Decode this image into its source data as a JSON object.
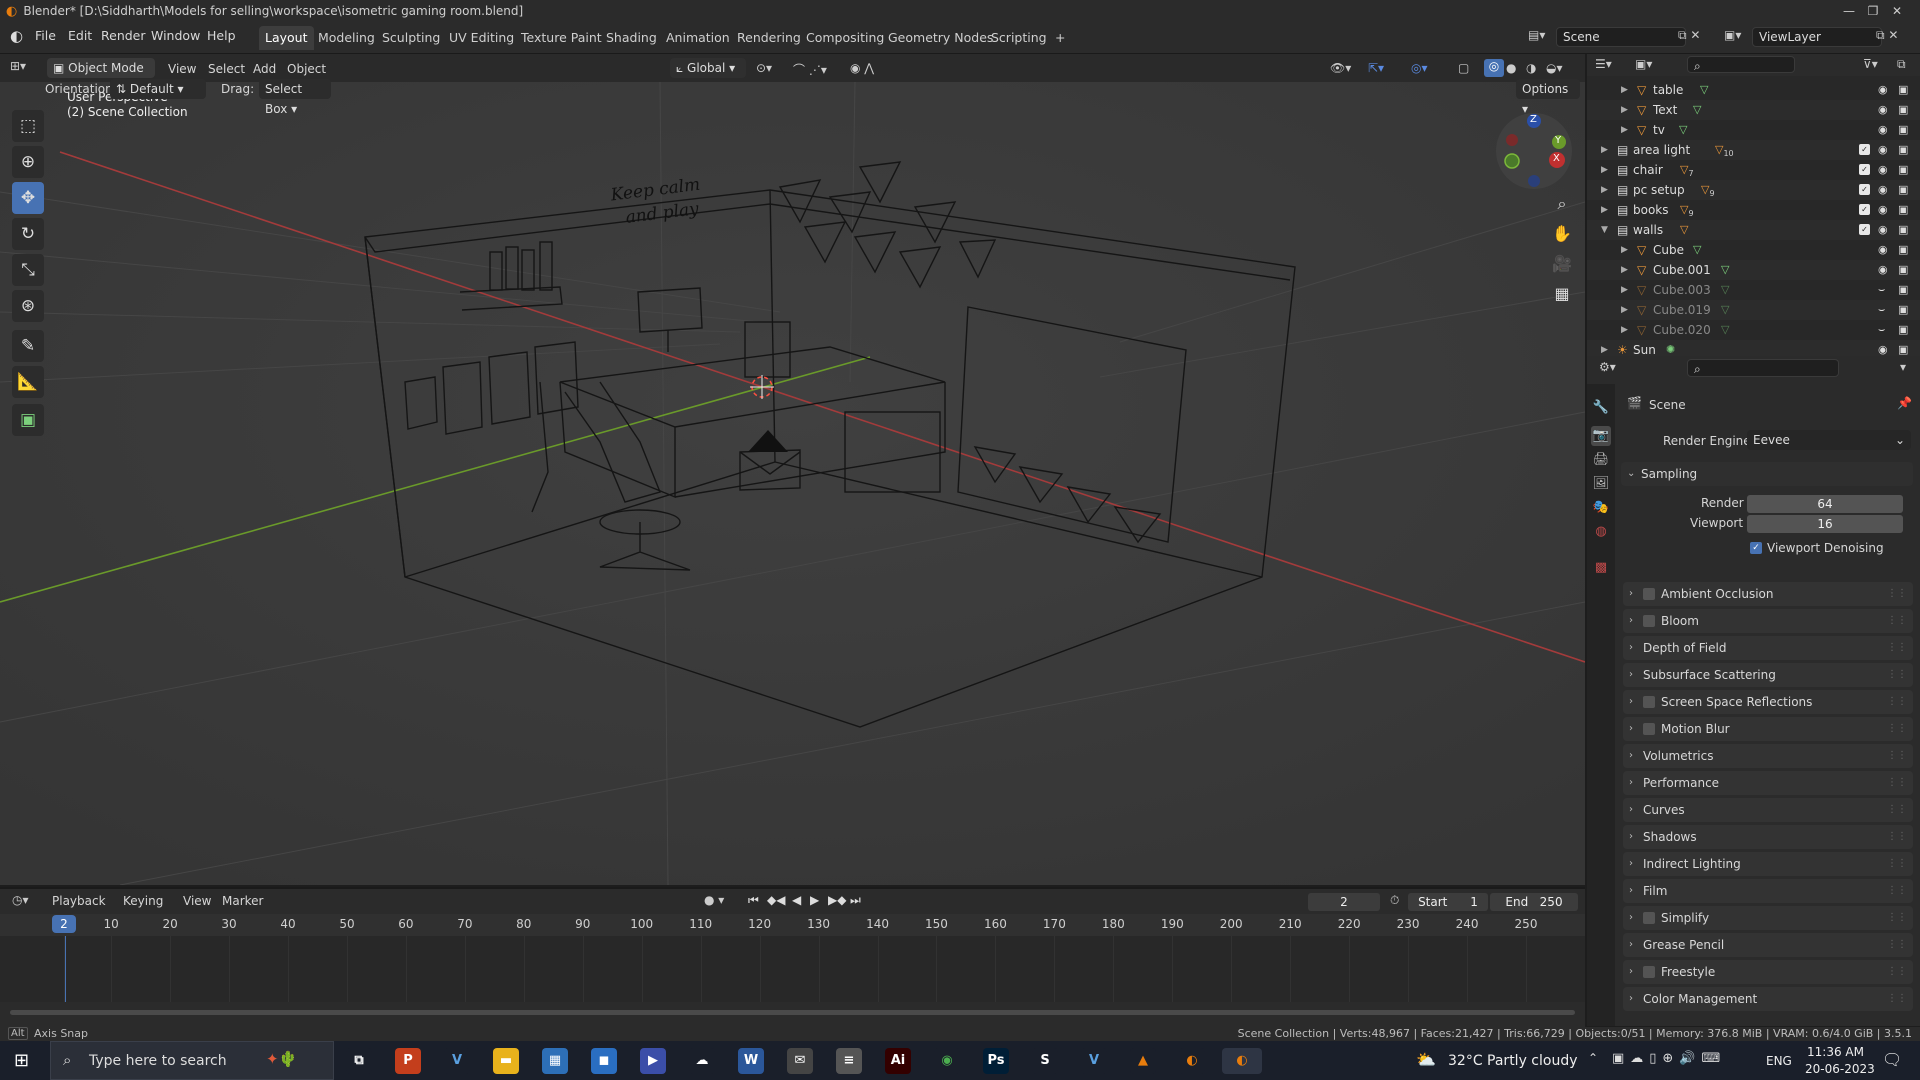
{
  "window": {
    "title": "Blender* [D:\\Siddharth\\Models for selling\\workspace\\isometric gaming room.blend]",
    "controls": [
      "—",
      "❐",
      "✕"
    ]
  },
  "menu": [
    "File",
    "Edit",
    "Render",
    "Window",
    "Help"
  ],
  "workspaces": [
    "Layout",
    "Modeling",
    "Sculpting",
    "UV Editing",
    "Texture Paint",
    "Shading",
    "Animation",
    "Rendering",
    "Compositing",
    "Geometry Nodes",
    "Scripting",
    "+"
  ],
  "scene_name": "Scene",
  "view_layer": "ViewLayer",
  "viewport_header": {
    "mode": "Object Mode",
    "menus": [
      "View",
      "Select",
      "Add",
      "Object"
    ],
    "transform": "Global",
    "orientation_label": "Orientation:",
    "orientation_value": "Default",
    "drag_label": "Drag:",
    "drag_value": "Select Box",
    "options": "Options"
  },
  "viewport": {
    "perspective": "User Perspective",
    "collection": "(2) Scene Collection",
    "gizmo_axes": [
      "Z",
      "Y",
      "X"
    ],
    "wall_text": [
      "Keep calm",
      "and play"
    ]
  },
  "toolbar_icons": [
    "select-box",
    "cursor",
    "move",
    "rotate",
    "scale",
    "transform",
    "annotate",
    "measure",
    "add-cube"
  ],
  "outliner": [
    {
      "name": "table",
      "indent": 2,
      "dim": false
    },
    {
      "name": "Text",
      "indent": 2,
      "dim": false
    },
    {
      "name": "tv",
      "indent": 2,
      "dim": false
    },
    {
      "name": "area light",
      "indent": 1,
      "dim": false,
      "count": "10"
    },
    {
      "name": "chair",
      "indent": 1,
      "dim": false,
      "count": "7"
    },
    {
      "name": "pc setup",
      "indent": 1,
      "dim": false,
      "count": "9"
    },
    {
      "name": "books",
      "indent": 1,
      "dim": false,
      "count": "9"
    },
    {
      "name": "walls",
      "indent": 1,
      "dim": false
    },
    {
      "name": "Cube",
      "indent": 2,
      "dim": false
    },
    {
      "name": "Cube.001",
      "indent": 2,
      "dim": false
    },
    {
      "name": "Cube.003",
      "indent": 2,
      "dim": true
    },
    {
      "name": "Cube.019",
      "indent": 2,
      "dim": true
    },
    {
      "name": "Cube.020",
      "indent": 2,
      "dim": true
    },
    {
      "name": "Sun",
      "indent": 1,
      "dim": false
    }
  ],
  "properties": {
    "context": "Scene",
    "render_engine_label": "Render Engine",
    "render_engine": "Eevee",
    "sampling_title": "Sampling",
    "render_label": "Render",
    "render_value": "64",
    "viewport_label": "Viewport",
    "viewport_value": "16",
    "denoise_label": "Viewport Denoising",
    "panels": [
      {
        "label": "Ambient Occlusion",
        "checkbox": true
      },
      {
        "label": "Bloom",
        "checkbox": true
      },
      {
        "label": "Depth of Field",
        "checkbox": false
      },
      {
        "label": "Subsurface Scattering",
        "checkbox": false
      },
      {
        "label": "Screen Space Reflections",
        "checkbox": true
      },
      {
        "label": "Motion Blur",
        "checkbox": true
      },
      {
        "label": "Volumetrics",
        "checkbox": false
      },
      {
        "label": "Performance",
        "checkbox": false
      },
      {
        "label": "Curves",
        "checkbox": false
      },
      {
        "label": "Shadows",
        "checkbox": false
      },
      {
        "label": "Indirect Lighting",
        "checkbox": false
      },
      {
        "label": "Film",
        "checkbox": false
      },
      {
        "label": "Simplify",
        "checkbox": true
      },
      {
        "label": "Grease Pencil",
        "checkbox": false
      },
      {
        "label": "Freestyle",
        "checkbox": true
      },
      {
        "label": "Color Management",
        "checkbox": false
      }
    ]
  },
  "timeline": {
    "menus": [
      "Playback",
      "Keying",
      "View",
      "Marker"
    ],
    "current_frame": "2",
    "start_label": "Start",
    "start": "1",
    "end_label": "End",
    "end": "250",
    "ticks": [
      "2",
      "10",
      "20",
      "30",
      "40",
      "50",
      "60",
      "70",
      "80",
      "90",
      "100",
      "110",
      "120",
      "130",
      "140",
      "150",
      "160",
      "170",
      "180",
      "190",
      "200",
      "210",
      "220",
      "230",
      "240",
      "250"
    ]
  },
  "status": {
    "left_key": "Alt",
    "left_text": "Axis Snap",
    "right": "Scene Collection | Verts:48,967 | Faces:21,427 | Tris:66,729 | Objects:0/51 | Memory: 376.8 MiB | VRAM: 0.6/4.0 GiB | 3.5.1"
  },
  "taskbar": {
    "search_placeholder": "Type here to search",
    "weather": "32°C  Partly cloudy",
    "lang": "ENG",
    "time": "11:36 AM",
    "date": "20-06-2023",
    "apps": [
      {
        "name": "task-view",
        "glyph": "⧉",
        "color": "#1a1f2a"
      },
      {
        "name": "powerpoint",
        "glyph": "P",
        "color": "#c43e1c"
      },
      {
        "name": "vectorworks",
        "glyph": "V",
        "color": "#1a1f2a"
      },
      {
        "name": "file-explorer",
        "glyph": "▬",
        "color": "#e8b21c"
      },
      {
        "name": "calculator",
        "glyph": "▦",
        "color": "#2d6fb7"
      },
      {
        "name": "store",
        "glyph": "◼",
        "color": "#2a6ec1"
      },
      {
        "name": "power-automate",
        "glyph": "▶",
        "color": "#3b4ea8"
      },
      {
        "name": "onedrive",
        "glyph": "☁",
        "color": "#1a1f2a"
      },
      {
        "name": "word",
        "glyph": "W",
        "color": "#2b579a"
      },
      {
        "name": "mail",
        "glyph": "✉",
        "color": "#444"
      },
      {
        "name": "stack",
        "glyph": "≡",
        "color": "#555"
      },
      {
        "name": "illustrator",
        "glyph": "Ai",
        "color": "#330000"
      },
      {
        "name": "chrome",
        "glyph": "◉",
        "color": "#1a1f2a"
      },
      {
        "name": "photoshop",
        "glyph": "Ps",
        "color": "#001e36"
      },
      {
        "name": "sketchup",
        "glyph": "S",
        "color": "#1a1f2a"
      },
      {
        "name": "vectorworks-2",
        "glyph": "V",
        "color": "#1a1f2a"
      },
      {
        "name": "vlc",
        "glyph": "▲",
        "color": "#1a1f2a"
      },
      {
        "name": "blender",
        "glyph": "◐",
        "color": "#1a1f2a"
      },
      {
        "name": "blender-active",
        "glyph": "◐",
        "color": "#2e3544"
      }
    ]
  },
  "colors": {
    "accent": "#4772b3",
    "x_axis": "#a33b3b",
    "y_axis": "#6a9a2a",
    "blender_orange": "#e87d0d"
  }
}
